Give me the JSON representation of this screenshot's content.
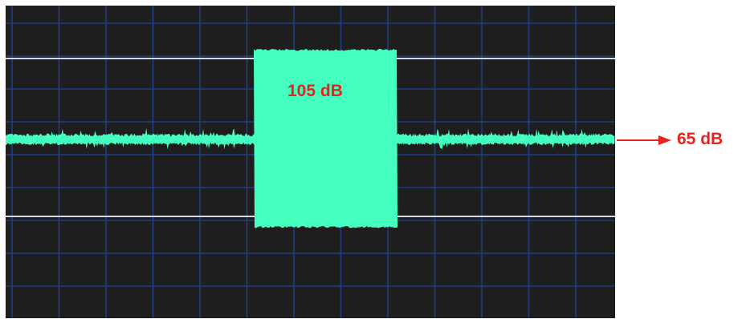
{
  "colors": {
    "background": "#1e1e1e",
    "grid": "#1f3d82",
    "reference_line": "#d8d8d8",
    "signal": "#45ffc0",
    "label": "#e8221f",
    "arrow": "#e8221f"
  },
  "labels": {
    "burst_level": "105 dB",
    "baseline_level": "65 dB"
  },
  "display": {
    "type": "oscilloscope-trace",
    "grid": true,
    "grid_columns": 13,
    "grid_rows": 9,
    "reference_lines": 2
  }
}
